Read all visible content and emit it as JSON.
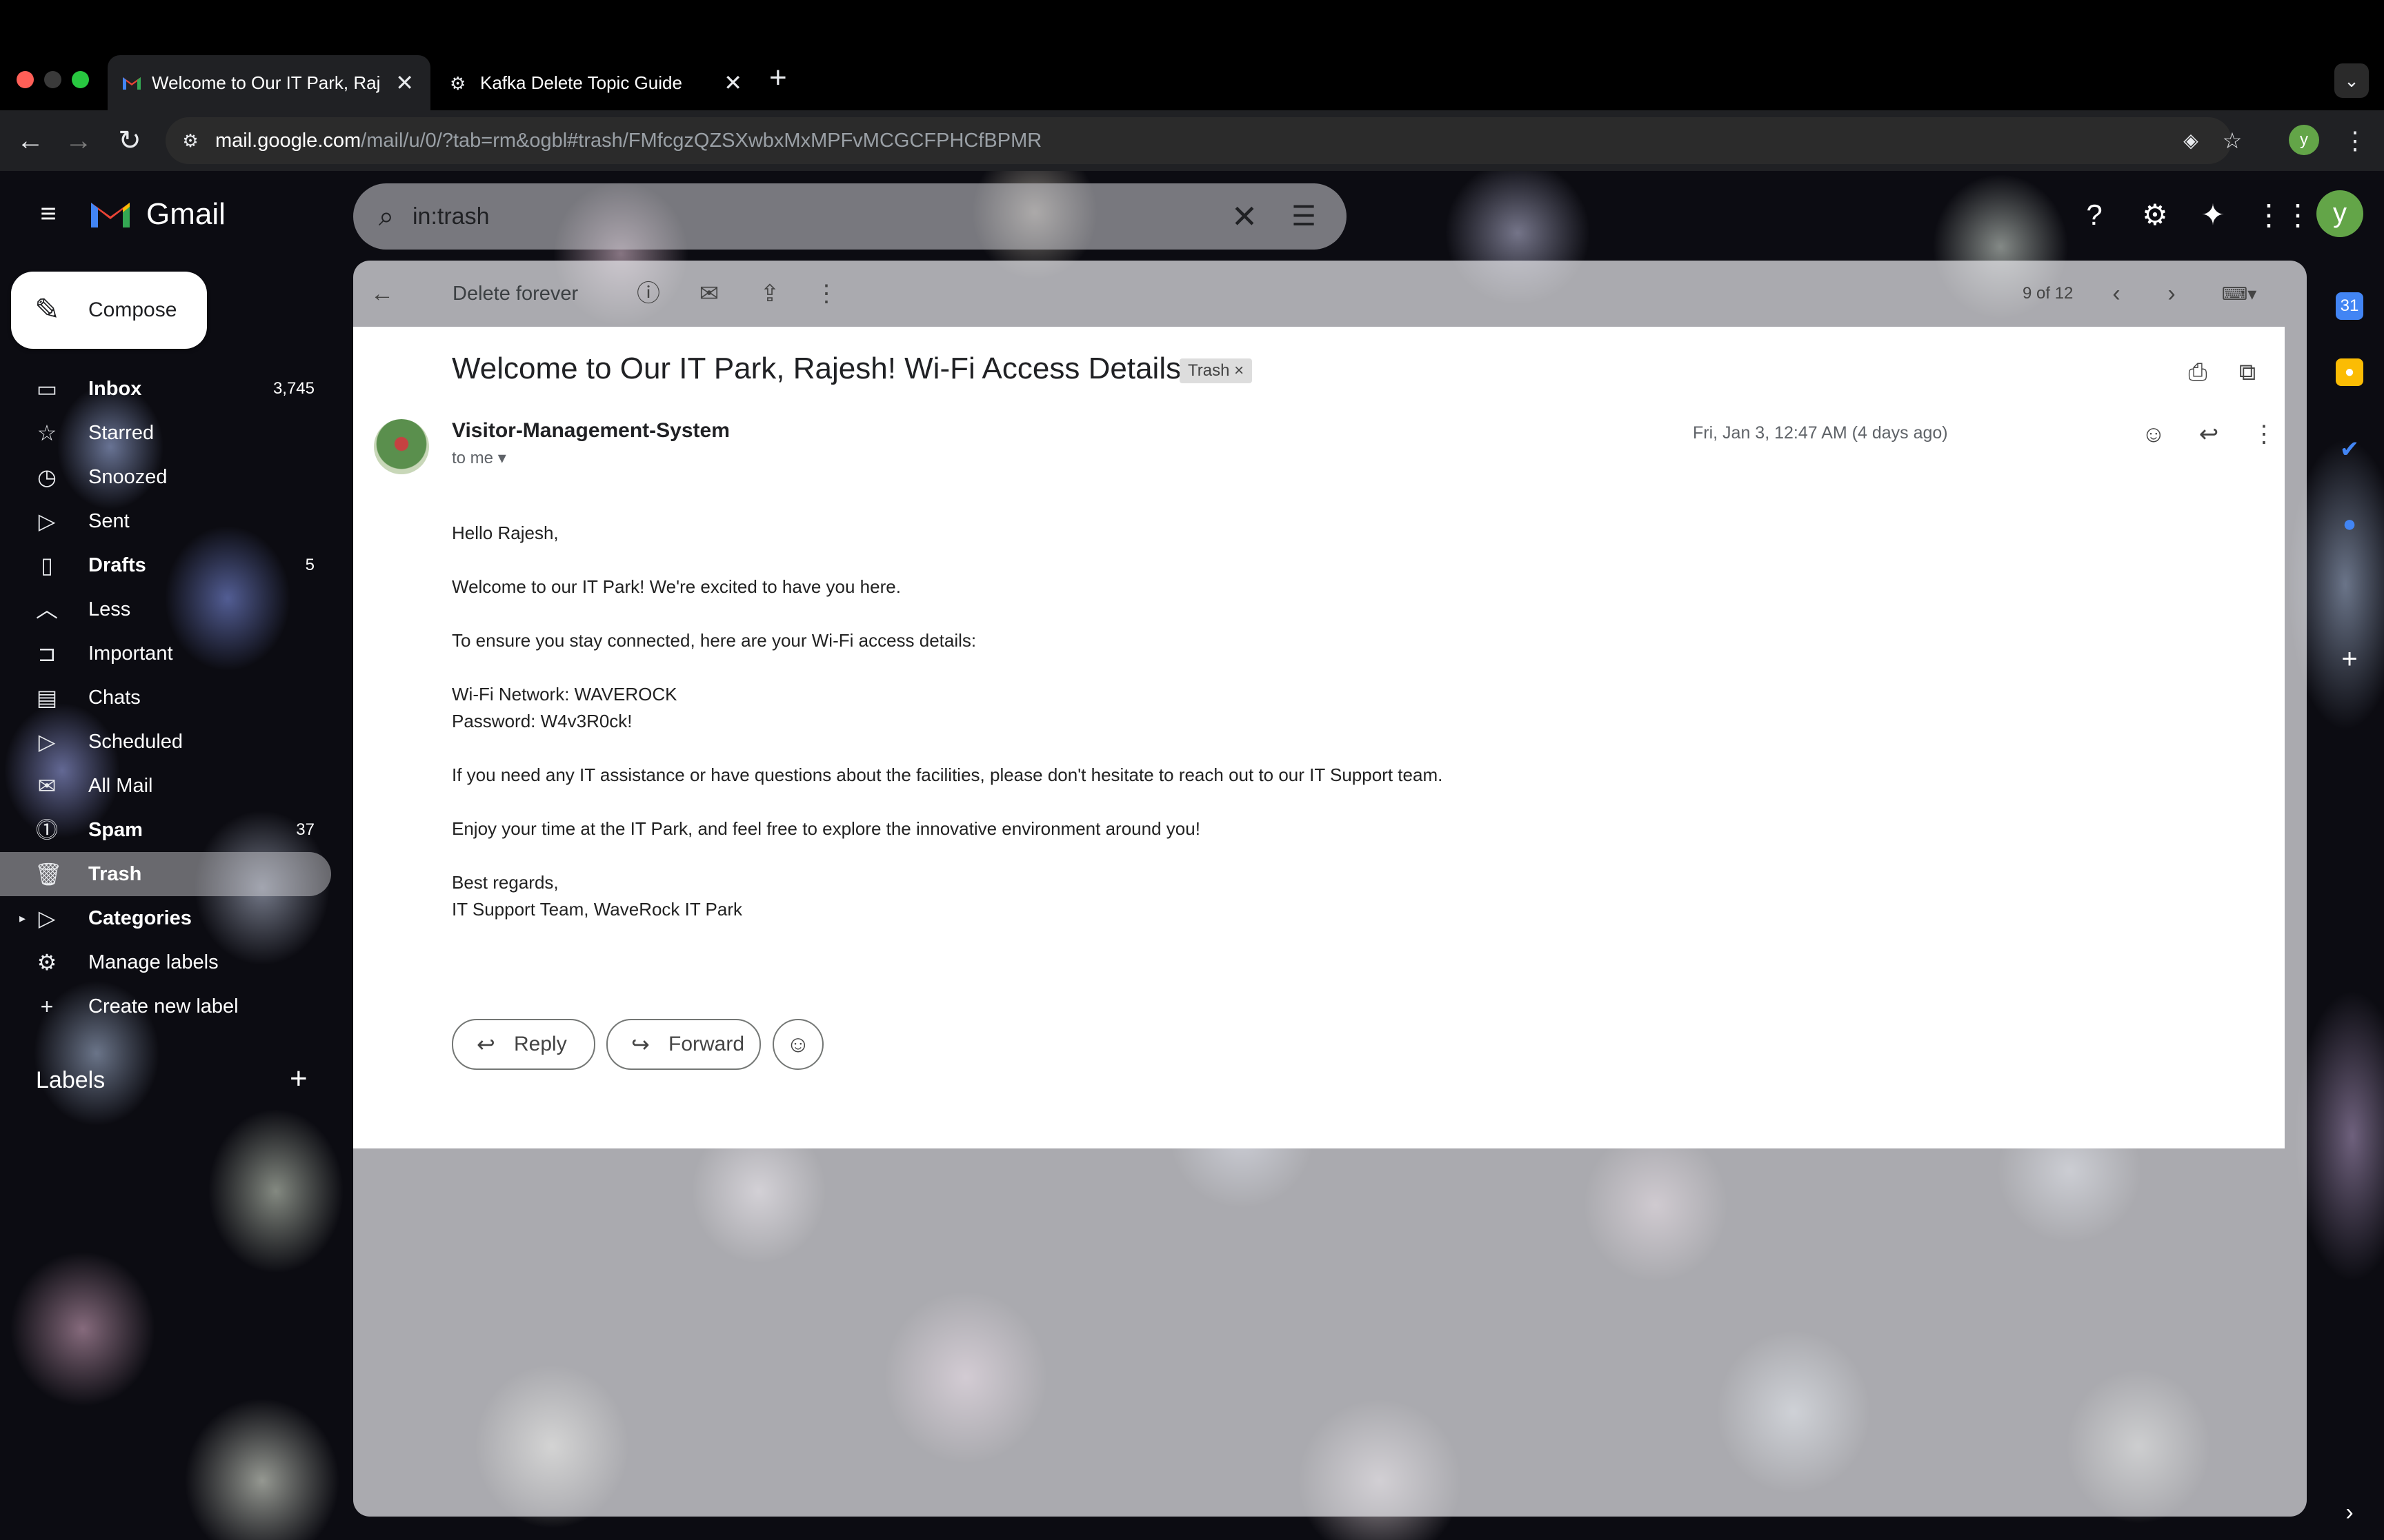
{
  "browser": {
    "tabs": [
      {
        "title": "Welcome to Our IT Park, Raje",
        "favicon": "gmail-icon",
        "active": true
      },
      {
        "title": "Kafka Delete Topic Guide",
        "favicon": "openai-icon",
        "active": false
      }
    ],
    "url_host": "mail.google.com",
    "url_path": "/mail/u/0/?tab=rm&ogbl#trash/FMfcgzQZSXwbxMxMPFvMCGCFPHCfBPMR",
    "profile_initial": "y"
  },
  "gmail": {
    "brand": "Gmail",
    "search_value": "in:trash",
    "avatar_initial": "y",
    "compose_label": "Compose",
    "nav": [
      {
        "label": "Inbox",
        "count": "3,745",
        "icon": "inbox-icon",
        "bold": true
      },
      {
        "label": "Starred",
        "count": "",
        "icon": "star-icon"
      },
      {
        "label": "Snoozed",
        "count": "",
        "icon": "clock-icon"
      },
      {
        "label": "Sent",
        "count": "",
        "icon": "send-icon"
      },
      {
        "label": "Drafts",
        "count": "5",
        "icon": "draft-icon",
        "bold": true
      },
      {
        "label": "Less",
        "count": "",
        "icon": "chevron-up-icon"
      },
      {
        "label": "Important",
        "count": "",
        "icon": "important-icon"
      },
      {
        "label": "Chats",
        "count": "",
        "icon": "chat-icon"
      },
      {
        "label": "Scheduled",
        "count": "",
        "icon": "scheduled-send-icon"
      },
      {
        "label": "All Mail",
        "count": "",
        "icon": "all-mail-icon"
      },
      {
        "label": "Spam",
        "count": "37",
        "icon": "spam-icon",
        "bold": true
      },
      {
        "label": "Trash",
        "count": "",
        "icon": "trash-icon",
        "bold": true,
        "selected": true
      },
      {
        "label": "Categories",
        "count": "",
        "icon": "label-icon",
        "bold": true
      },
      {
        "label": "Manage labels",
        "count": "",
        "icon": "gear-icon"
      },
      {
        "label": "Create new label",
        "count": "",
        "icon": "plus-icon"
      }
    ],
    "labels_header": "Labels",
    "toolbar": {
      "delete_forever": "Delete forever",
      "counter": "9 of 12"
    },
    "message": {
      "subject": "Welcome to Our IT Park, Rajesh! Wi-Fi Access Details",
      "chip": "Trash",
      "sender": "Visitor-Management-System",
      "to": "to me",
      "date": "Fri, Jan 3, 12:47 AM (4 days ago)",
      "body": {
        "greeting": "Hello Rajesh,",
        "p1": "Welcome to our IT Park! We're excited to have you here.",
        "p2": "To ensure you stay connected, here are your Wi-Fi access details:",
        "network": "Wi-Fi Network: WAVEROCK",
        "password": "Password: W4v3R0ck!",
        "p3": "If you need any IT assistance or have questions about the facilities, please don't hesitate to reach out to our IT Support team.",
        "p4": "Enjoy your time at the IT Park, and feel free to explore the innovative environment around you!",
        "signoff": "Best regards,",
        "signature": "IT Support Team, WaveRock IT Park"
      },
      "reply_label": "Reply",
      "forward_label": "Forward"
    }
  },
  "colors": {
    "gmail_red": "#ea4335",
    "gmail_blue": "#4285f4",
    "gmail_green": "#34a853",
    "gmail_yellow": "#fbbc04",
    "avatar_green": "#63a548"
  }
}
